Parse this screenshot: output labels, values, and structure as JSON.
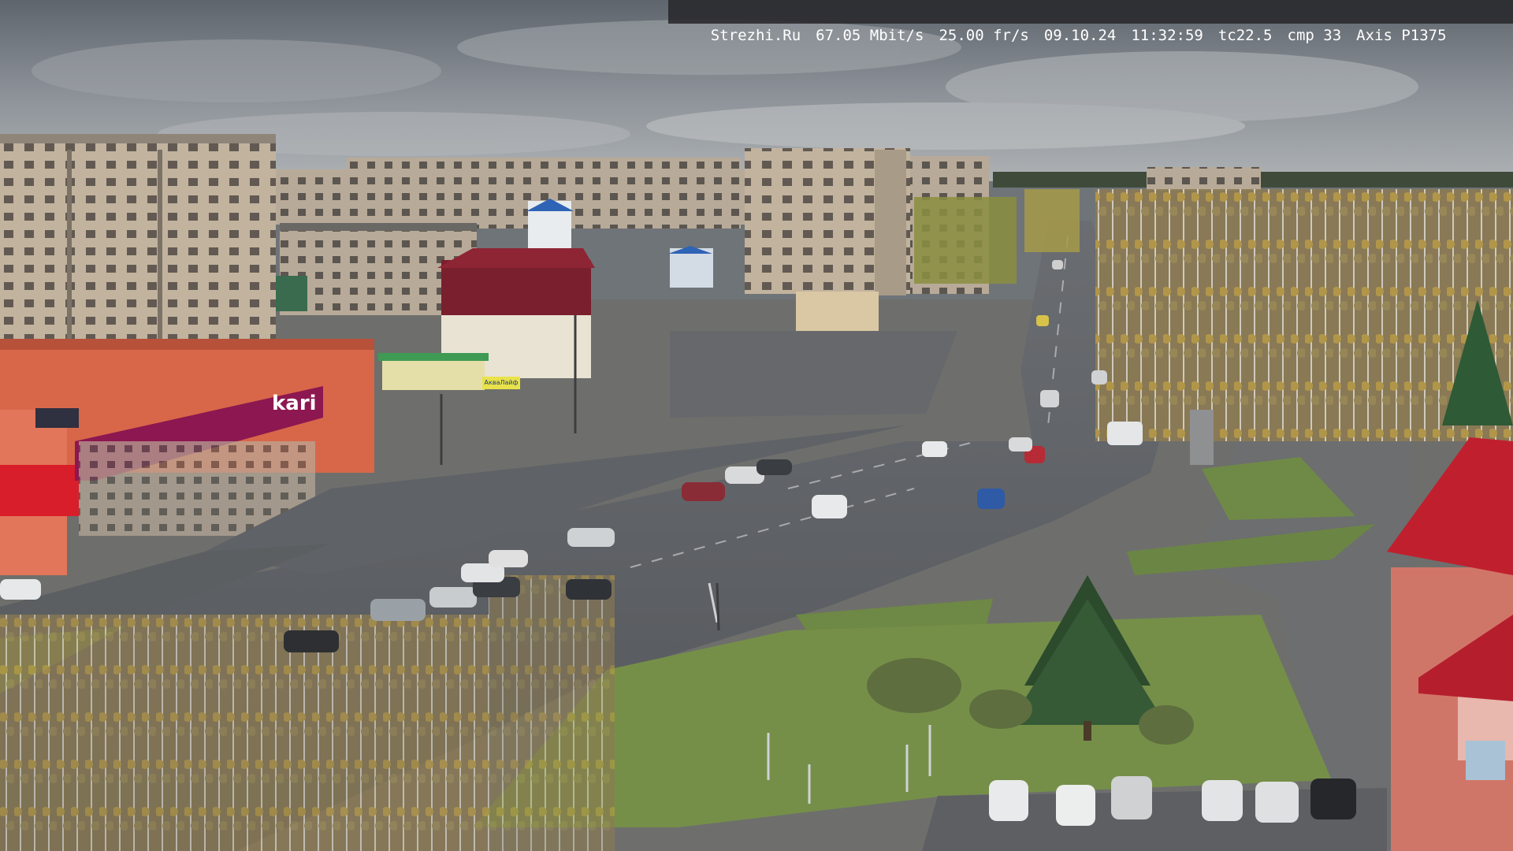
{
  "overlay": {
    "site": "Strezhi.Ru",
    "bitrate": "67.05 Mbit/s",
    "framerate": "25.00 fr/s",
    "date": "09.10.24",
    "time": "11:32:59",
    "tc": "tc22.5",
    "cmp": "cmp 33",
    "camera": "Axis P1375"
  },
  "scene": {
    "description_tags": [
      "town-square",
      "overcast-sky",
      "apartment-blocks",
      "autumn-trees",
      "road-intersection",
      "parking-lot"
    ],
    "colors": {
      "sky": "#8b9096",
      "road": "#5d6064",
      "grass": "#6f8a47",
      "autumn": "#c7a24a",
      "shop_brand": "#9c1a5b",
      "shop_wall": "#d8674a",
      "tower_red": "#c0202e"
    }
  },
  "signage": {
    "kari": "kari",
    "akvalife": "АкваЛайф"
  }
}
